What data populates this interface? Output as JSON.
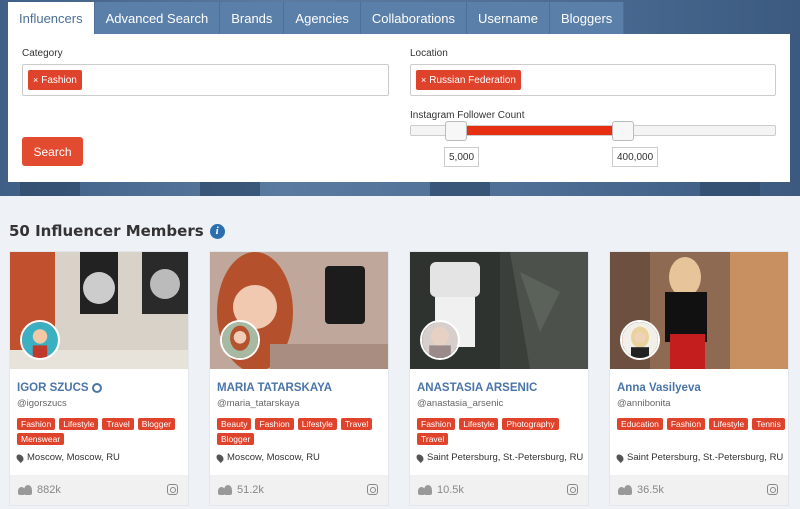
{
  "tabs": [
    "Influencers",
    "Advanced Search",
    "Brands",
    "Agencies",
    "Collaborations",
    "Username",
    "Bloggers"
  ],
  "search": {
    "category_label": "Category",
    "category_chip": "Fashion",
    "location_label": "Location",
    "location_chip": "Russian Federation",
    "follower_label": "Instagram Follower Count",
    "min_value": "5,000",
    "max_value": "400,000",
    "button": "Search",
    "chip_remove": "×"
  },
  "results": {
    "heading": "50 Influencer Members",
    "info_glyph": "i"
  },
  "cards": [
    {
      "name": "IGOR SZUCS",
      "verified": true,
      "handle": "@igorszucs",
      "tags": [
        "Fashion",
        "Lifestyle",
        "Travel",
        "Blogger",
        "Menswear"
      ],
      "location": "Moscow, Moscow, RU",
      "followers": "882k"
    },
    {
      "name": "MARIA TATARSKAYA",
      "verified": false,
      "handle": "@maria_tatarskaya",
      "tags": [
        "Beauty",
        "Fashion",
        "Lifestyle",
        "Travel",
        "Blogger"
      ],
      "location": "Moscow, Moscow, RU",
      "followers": "51.2k"
    },
    {
      "name": "ANASTASIA ARSENIC",
      "verified": false,
      "handle": "@anastasia_arsenic",
      "tags": [
        "Fashion",
        "Lifestyle",
        "Photography",
        "Travel"
      ],
      "location": "Saint Petersburg, St.-Petersburg, RU",
      "followers": "10.5k"
    },
    {
      "name": "Anna Vasilyeva",
      "verified": false,
      "handle": "@annibonita",
      "tags": [
        "Education",
        "Fashion",
        "Lifestyle",
        "Tennis"
      ],
      "location": "Saint Petersburg, St.-Petersburg, RU",
      "followers": "36.5k"
    }
  ]
}
